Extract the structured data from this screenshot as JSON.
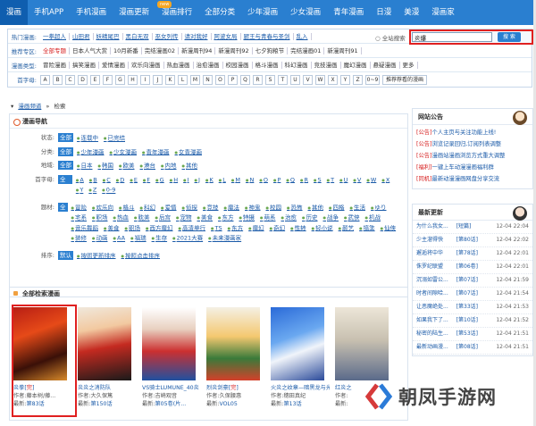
{
  "nav": {
    "items": [
      "漫画",
      "手机APP",
      "手机漫画",
      "漫画更新",
      "漫画排行",
      "全部分类",
      "少年漫画",
      "少女漫画",
      "青年漫画",
      "日漫",
      "美漫",
      "漫画家"
    ],
    "badge": "new"
  },
  "filters": {
    "hot": {
      "label": "热门漫画:",
      "items": [
        "一拳超人",
        "山田君",
        "妖精尾巴",
        "黑白无双",
        "巫女列传",
        "请对我好",
        "阿波女局",
        "厨王与青春与圣剑",
        "乱入"
      ]
    },
    "rec": {
      "label": "推荐专区:",
      "items": [
        "全部专题",
        "日本人气大赏",
        "10月新番",
        "完结漫画02",
        "新漫周刊94",
        "新漫周刊92",
        "七夕狗粮节",
        "完结漫画01",
        "新漫周刊91"
      ],
      "first": "全部专题"
    },
    "type": {
      "label": "漫画类型:",
      "items": [
        "冒险漫画",
        "搞笑漫画",
        "爱情漫画",
        "欢乐向漫画",
        "热血漫画",
        "治愈漫画",
        "校园漫画",
        "格斗漫画",
        "科幻漫画",
        "竞技漫画",
        "魔幻漫画",
        "悬疑漫画",
        "更多"
      ]
    },
    "letter": {
      "label": "首字母:",
      "items": [
        "A",
        "B",
        "C",
        "D",
        "E",
        "F",
        "G",
        "H",
        "I",
        "J",
        "K",
        "L",
        "M",
        "N",
        "O",
        "P",
        "Q",
        "R",
        "S",
        "T",
        "U",
        "V",
        "W",
        "X",
        "Y",
        "Z",
        "0~9"
      ],
      "pref": "推荐荐看的漫画"
    }
  },
  "search": {
    "left_label": "全站搜索",
    "value": "炎爆",
    "button": "搜 索"
  },
  "breadcrumb": {
    "home": "漫画频道",
    "sep": "»",
    "current": "检索"
  },
  "guide": {
    "title": "漫画导航",
    "all": "全部",
    "status": {
      "label": "状态:",
      "opts": [
        "连载中",
        "已完结"
      ]
    },
    "cat": {
      "label": "分类:",
      "opts": [
        "少年漫画",
        "少女漫画",
        "青年漫画",
        "女青漫画"
      ]
    },
    "region": {
      "label": "地域:",
      "opts": [
        "日本",
        "韩国",
        "欧美",
        "港台",
        "内地",
        "其他"
      ]
    },
    "letters": {
      "label": "首字母:",
      "opts": [
        "A",
        "B",
        "C",
        "D",
        "E",
        "F",
        "G",
        "H",
        "I",
        "J",
        "K",
        "L",
        "M",
        "N",
        "O",
        "P",
        "Q",
        "R",
        "S",
        "T",
        "U",
        "V",
        "W",
        "X",
        "Y",
        "Z",
        "0-9"
      ]
    },
    "theme": {
      "label": "题材:",
      "opts": [
        "冒险",
        "欢乐向",
        "格斗",
        "科幻",
        "爱情",
        "侦探",
        "竞技",
        "魔法",
        "神鬼",
        "校园",
        "恐怖",
        "其他",
        "四格",
        "生活",
        "ゆり",
        "宅系",
        "职场",
        "热血",
        "耽美",
        "后宫",
        "宠物",
        "美食",
        "东方",
        "特摄",
        "萌系",
        "治愈",
        "历史",
        "战争",
        "武侠",
        "机战",
        "音乐舞蹈",
        "美食",
        "职场",
        "西方魔幻",
        "高清单行",
        "TS",
        "东方",
        "魔幻",
        "奇幻",
        "性转",
        "轻小说",
        "颜艺",
        "搞笑",
        "仙侠",
        "装修",
        "动画",
        "AA",
        "福瑞",
        "生存",
        "2021大赛",
        "未来漫画家"
      ]
    },
    "sort": {
      "label": "排序:",
      "active": "默认",
      "opts": [
        "按照更新排序",
        "按照点击排序"
      ]
    }
  },
  "results": {
    "title": "全部检索漫画",
    "items": [
      {
        "title": "炎拳",
        "tag": "完",
        "author": "作者:藤本树/藤...",
        "latest_label": "最新:",
        "latest": "第83话"
      },
      {
        "title": "炎炎之消防队",
        "tag": "",
        "author": "作者:大久保篤",
        "latest_label": "最新:",
        "latest": "第150话"
      },
      {
        "title": "VS骑士LUMUNE_40炎",
        "tag": "",
        "author": "作者:吉崎观音",
        "latest_label": "最新:",
        "latest": "第05卷(片..."
      },
      {
        "title": "烈炎剑豪",
        "tag": "完",
        "author": "作者:久保腰惠",
        "latest_label": "最新:",
        "latest": "VOL05"
      },
      {
        "title": "火炎之纹章—暗黑龙与光之剑",
        "tag": "完",
        "author": "作者:穗田真纪",
        "latest_label": "最新:",
        "latest": "第13话"
      },
      {
        "title": "红炎之",
        "tag": "",
        "author": "作者:",
        "latest_label": "最新:",
        "latest": ""
      }
    ]
  },
  "announce": {
    "title": "网站公告",
    "items": [
      {
        "tag": "[公告]",
        "text": "个人主页与关注功能上线!"
      },
      {
        "tag": "[公告]",
        "text": "浏览记录回归,订阅列表调整"
      },
      {
        "tag": "[公告]",
        "text": "漫画站漫画浏览方式重大调整"
      },
      {
        "tag": "[福利]",
        "text": "一键上车动漫漫画福利群"
      },
      {
        "tag": "[同机]",
        "text": "最新动漫漫画网盘分享交流"
      }
    ]
  },
  "updates": {
    "title": "最新更新",
    "items": [
      {
        "name": "为什么我女...",
        "chap": "[短篇]",
        "date": "12-04 22:04"
      },
      {
        "name": "少主溜得快",
        "chap": "[第80话]",
        "date": "12-04 22:02"
      },
      {
        "name": "邂逅将中华",
        "chap": "[第78话]",
        "date": "12-04 22:01"
      },
      {
        "name": "侏罗纪联盟",
        "chap": "[第06卷]",
        "date": "12-04 22:01"
      },
      {
        "name": "沉溺如雷公...",
        "chap": "[第07话]",
        "date": "12-04 21:59"
      },
      {
        "name": "时者间隙哈...",
        "chap": "[第07话]",
        "date": "12-04 21:54"
      },
      {
        "name": "让恶魔绝处...",
        "chap": "[第33话]",
        "date": "12-04 21:53"
      },
      {
        "name": "如果我下了...",
        "chap": "[第10话]",
        "date": "12-04 21:52"
      },
      {
        "name": "秘密的陆生...",
        "chap": "[第53话]",
        "date": "12-04 21:51"
      },
      {
        "name": "最新动画漫...",
        "chap": "[第08话]",
        "date": "12-04 21:51"
      }
    ]
  },
  "watermark": "朝凤手游网",
  "colors": {
    "nav": "#2a7fd0",
    "accent": "#e02020",
    "link": "#1a5aa8"
  }
}
